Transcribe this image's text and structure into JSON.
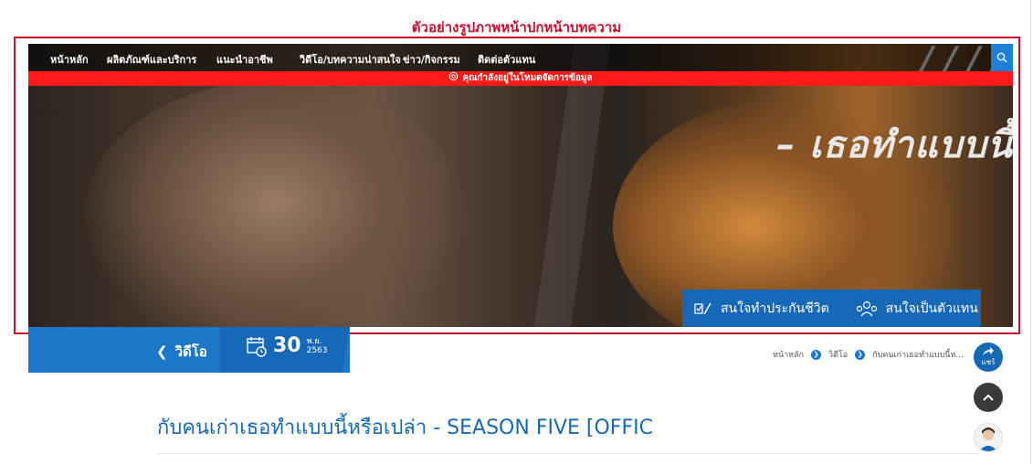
{
  "caption": "ตัวอย่างรูปภาพหน้าปกหน้าบทความ",
  "nav": {
    "items": [
      "หน้าหลัก",
      "ผลิตภัณฑ์และบริการ",
      "แนะนำอาชีพ",
      "วิดีโอ/บทความน่าสนใจ",
      "ข่าว/กิจกรรม",
      "ติดต่อตัวแทน"
    ]
  },
  "alert": {
    "text": "คุณกำลังอยู่ในโหมดจัดการข้อมูล"
  },
  "hero": {
    "title_line1": "/ / / /",
    "title_line2": "– เธอทำแบบนี้"
  },
  "cta": {
    "insurance_label": "สนใจทำประกันชีวิต",
    "agent_label": "สนใจเป็นตัวแทน"
  },
  "subbar": {
    "back_label": "วิดีโอ",
    "date_day": "30",
    "date_month": "พ.ย.",
    "date_year": "2563"
  },
  "breadcrumb": {
    "home": "หน้าหลัก",
    "video": "วิดีโอ",
    "current": "กับคนเก่าเธอทำแบบนี้ห..."
  },
  "share_label": "แชร์",
  "article": {
    "title": "กับคนเก่าเธอทำแบบนี้หรือเปล่า - SEASON FIVE [OFFIC"
  },
  "colors": {
    "accent": "#1669b6",
    "alert": "#ff1a1a",
    "caption": "#c8102e"
  }
}
